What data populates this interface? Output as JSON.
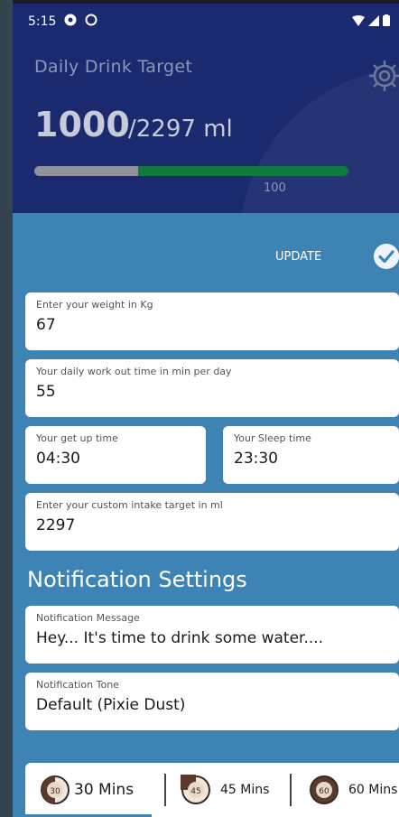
{
  "status_bar": {
    "time": "5:15"
  },
  "header": {
    "target_label": "Daily Drink Target",
    "consumed": "1000",
    "target": "/2297 ml",
    "progress_label": "100",
    "progress_fraction": 0.33
  },
  "actions": {
    "update_label": "UPDATE"
  },
  "form": {
    "weight_label": "Enter your weight in Kg",
    "weight_value": "67",
    "workout_label": "Your daily work out time in min per day",
    "workout_value": "55",
    "getup_label": "Your get up time",
    "getup_value": "04:30",
    "sleep_label": "Your Sleep time",
    "sleep_value": "23:30",
    "custom_label": "Enter your custom intake target in ml",
    "custom_value": "2297"
  },
  "notification": {
    "section_title": "Notification Settings",
    "message_label": "Notification Message",
    "message_value": "Hey... It's time to  drink some water....",
    "tone_label": "Notification Tone",
    "tone_value": "Default (Pixie Dust)"
  },
  "intervals": [
    {
      "icon_text": "30",
      "label": "30 Mins",
      "selected": true
    },
    {
      "icon_text": "45",
      "label": "45 Mins",
      "selected": false
    },
    {
      "icon_text": "60",
      "label": "60 Mins",
      "selected": false
    }
  ],
  "colors": {
    "header_bg": "#1b2a6e",
    "screen_bg": "#3d83b4",
    "progress_green": "#0f7a3c"
  }
}
